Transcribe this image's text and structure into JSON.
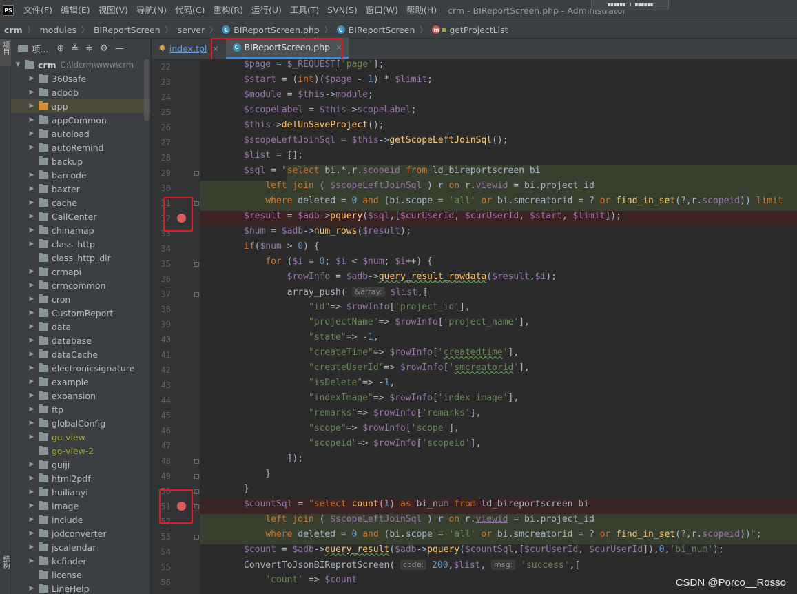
{
  "menubar": {
    "logo": "PS",
    "items": [
      "文件(F)",
      "编辑(E)",
      "视图(V)",
      "导航(N)",
      "代码(C)",
      "重构(R)",
      "运行(U)",
      "工具(T)",
      "SVN(S)",
      "窗口(W)",
      "帮助(H)"
    ],
    "window_title": "crm - BIReportScreen.php - Administrator",
    "top_widget": "▪▪▪▪▪▪ ⬇ ▪▪▪▪▪▪"
  },
  "breadcrumb": [
    "crm",
    "modules",
    "BIReportScreen",
    "server",
    "BIReportScreen.php",
    "BIReportScreen",
    "getProjectList"
  ],
  "toolstrip": {
    "top_label": "项目",
    "bottom_label": "结构"
  },
  "project_panel": {
    "title": "项...",
    "root": {
      "name": "crm",
      "path": "C:\\ldcrm\\www\\crm"
    },
    "folders": [
      {
        "name": "360safe",
        "expandable": true
      },
      {
        "name": "adodb",
        "expandable": true
      },
      {
        "name": "app",
        "expandable": true,
        "selected": true,
        "orange": true
      },
      {
        "name": "appCommon",
        "expandable": true
      },
      {
        "name": "autoload",
        "expandable": true
      },
      {
        "name": "autoRemind",
        "expandable": true
      },
      {
        "name": "backup",
        "expandable": false
      },
      {
        "name": "barcode",
        "expandable": true
      },
      {
        "name": "baxter",
        "expandable": true
      },
      {
        "name": "cache",
        "expandable": true
      },
      {
        "name": "CallCenter",
        "expandable": true
      },
      {
        "name": "chinamap",
        "expandable": true
      },
      {
        "name": "class_http",
        "expandable": true
      },
      {
        "name": "class_http_dir",
        "expandable": false
      },
      {
        "name": "crmapi",
        "expandable": true
      },
      {
        "name": "crmcommon",
        "expandable": true
      },
      {
        "name": "cron",
        "expandable": true
      },
      {
        "name": "CustomReport",
        "expandable": true
      },
      {
        "name": "data",
        "expandable": true
      },
      {
        "name": "database",
        "expandable": true
      },
      {
        "name": "dataCache",
        "expandable": true
      },
      {
        "name": "electronicsignature",
        "expandable": true
      },
      {
        "name": "example",
        "expandable": true
      },
      {
        "name": "expansion",
        "expandable": true
      },
      {
        "name": "ftp",
        "expandable": true
      },
      {
        "name": "globalConfig",
        "expandable": true
      },
      {
        "name": "go-view",
        "expandable": true,
        "olive": true
      },
      {
        "name": "go-view-2",
        "expandable": false,
        "olive": true
      },
      {
        "name": "guiji",
        "expandable": true
      },
      {
        "name": "html2pdf",
        "expandable": true
      },
      {
        "name": "huilianyi",
        "expandable": true
      },
      {
        "name": "Image",
        "expandable": true
      },
      {
        "name": "include",
        "expandable": true
      },
      {
        "name": "jodconverter",
        "expandable": true
      },
      {
        "name": "jscalendar",
        "expandable": true
      },
      {
        "name": "kcfinder",
        "expandable": true
      },
      {
        "name": "license",
        "expandable": false
      },
      {
        "name": "LineHelp",
        "expandable": true
      }
    ]
  },
  "tabs": [
    {
      "label": "index.tpl",
      "active": false
    },
    {
      "label": "BIReportScreen.php",
      "active": true
    }
  ],
  "editor": {
    "line_numbers": [
      22,
      23,
      24,
      25,
      26,
      27,
      28,
      29,
      30,
      31,
      32,
      33,
      34,
      35,
      36,
      37,
      38,
      39,
      40,
      41,
      42,
      43,
      44,
      45,
      46,
      47,
      48,
      49,
      50,
      51,
      52,
      53,
      54,
      55,
      56
    ],
    "breakpoints": [
      32,
      51
    ],
    "hints": {
      "array": "&array:",
      "code": "code:",
      "msg": "msg:"
    }
  },
  "watermark": "CSDN @Porco__Rosso"
}
